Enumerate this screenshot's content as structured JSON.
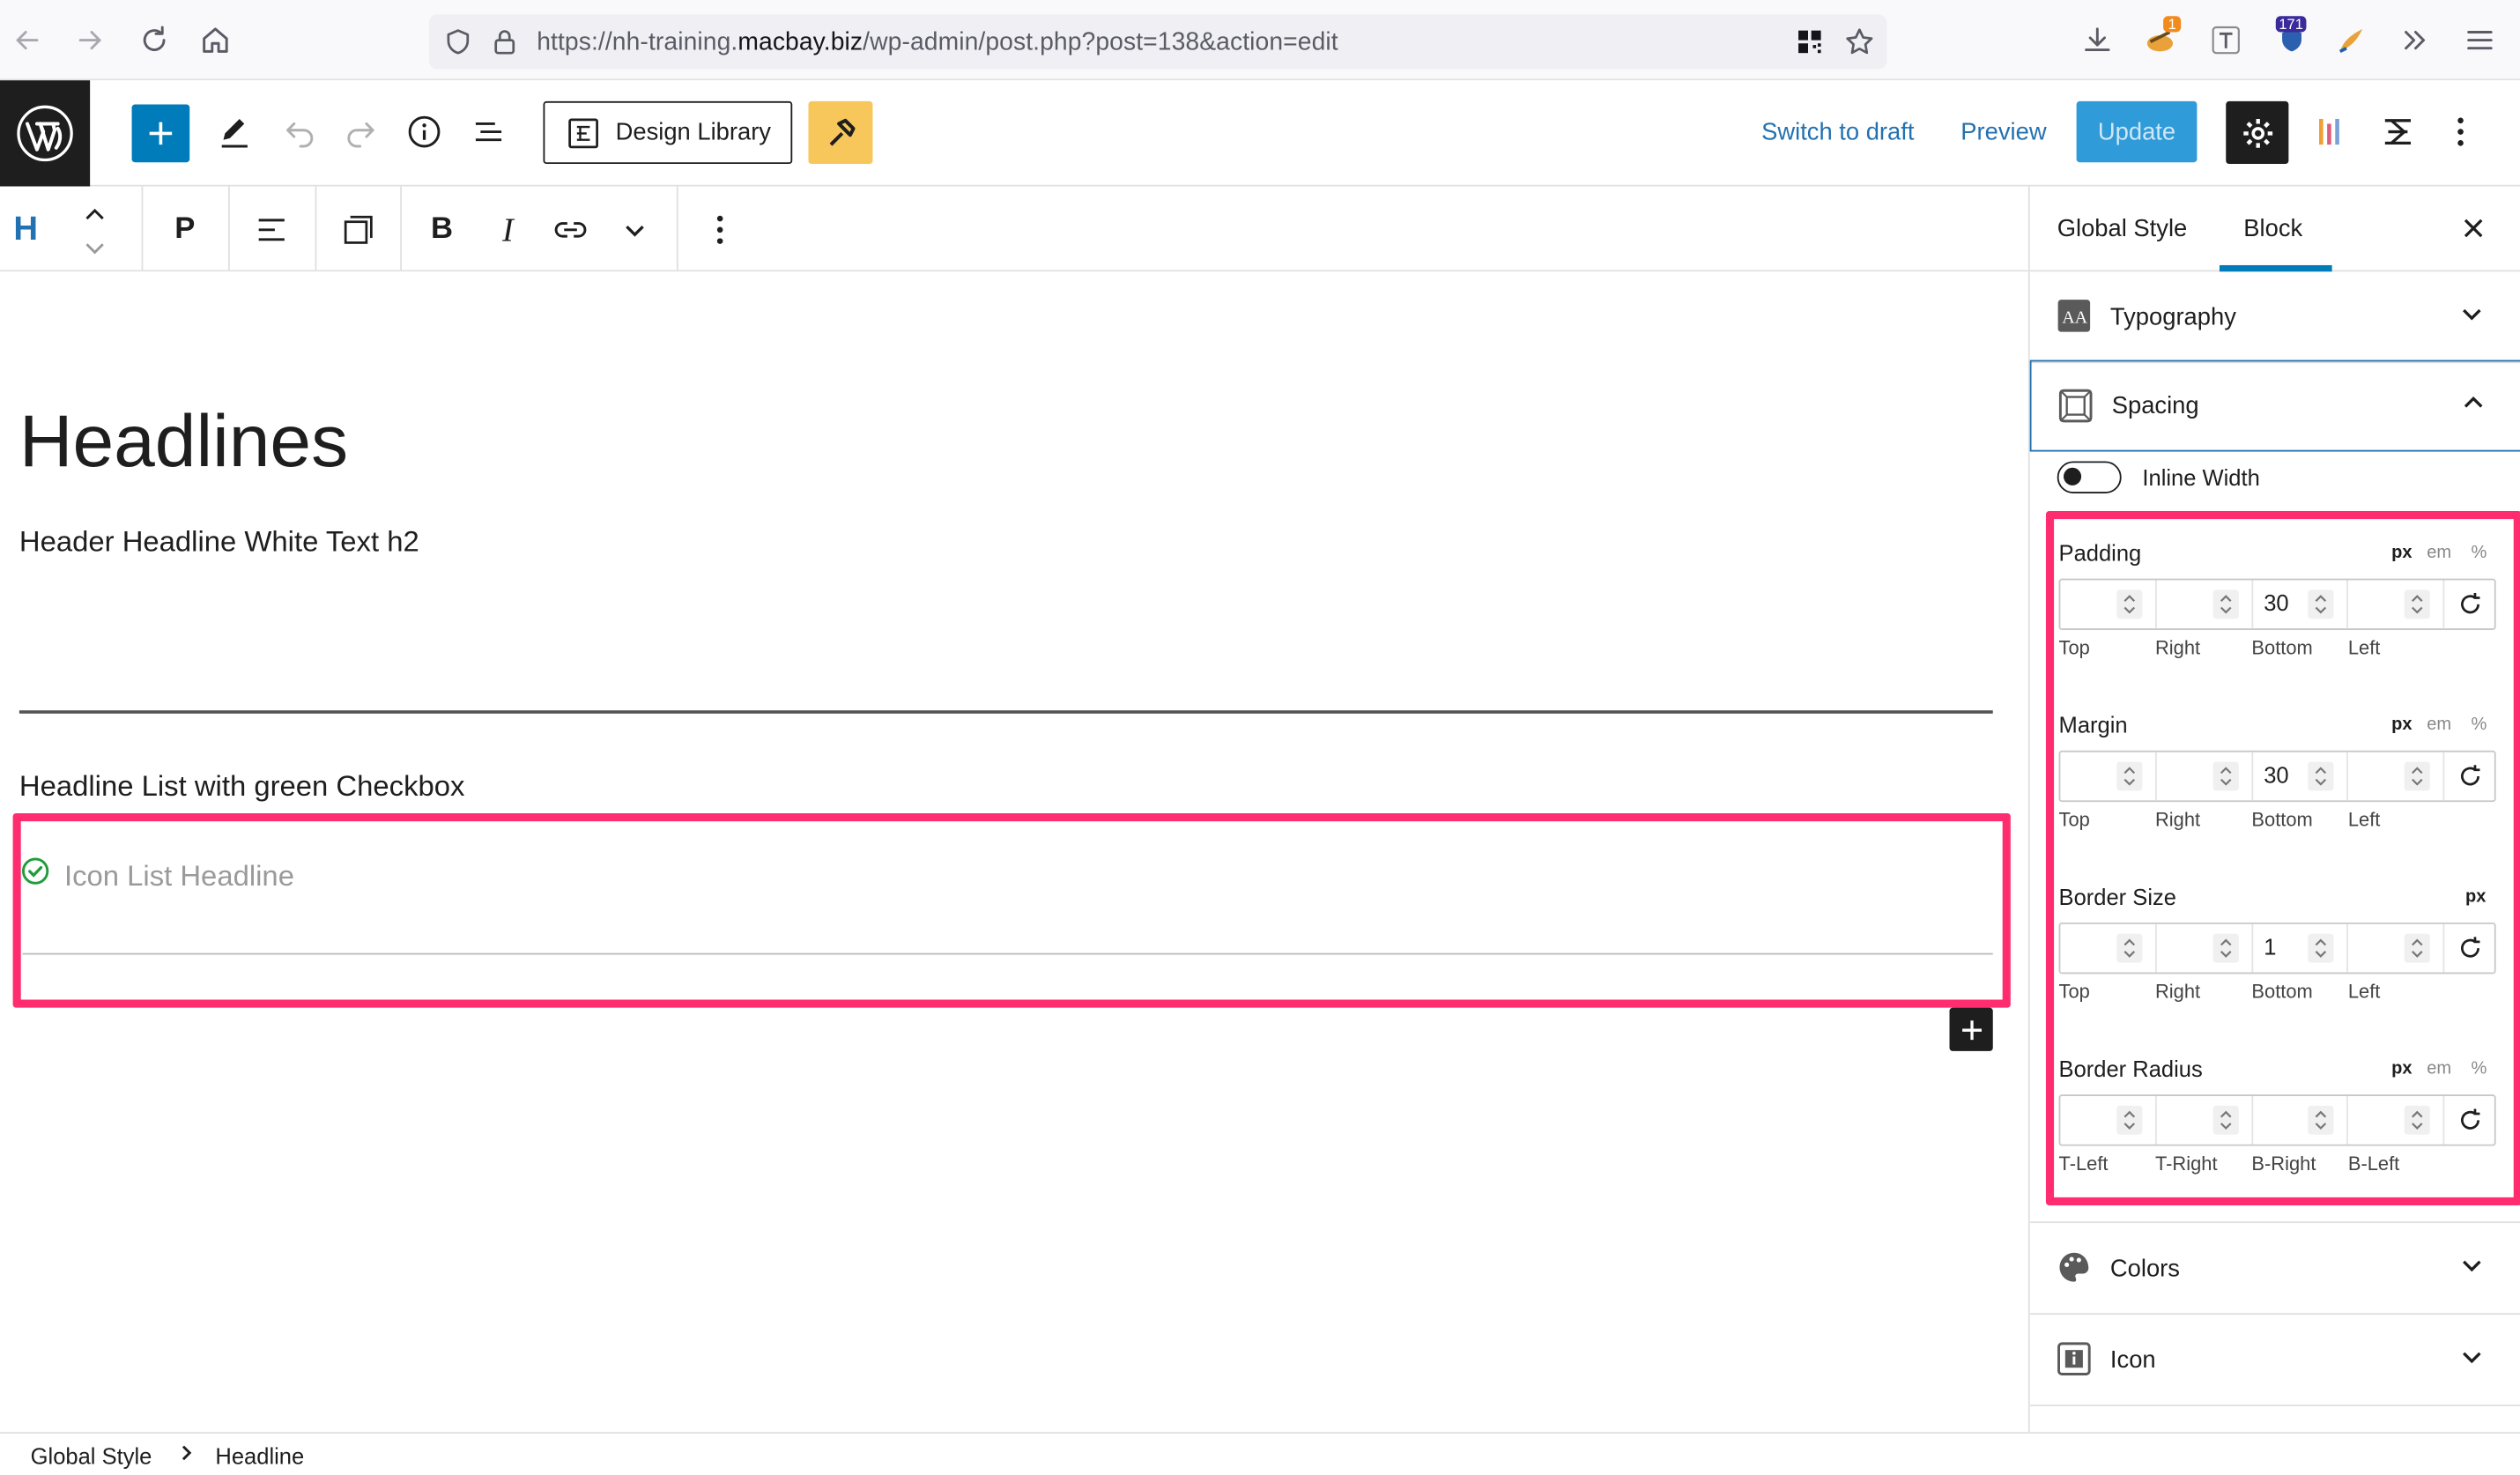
{
  "browser": {
    "url_prefix": "https://nh-training.",
    "url_domain": "macbay.biz",
    "url_path": "/wp-admin/post.php?post=138&action=edit",
    "badge_one": "1",
    "badge_two": "171",
    "icons": [
      "back-arrow-icon",
      "forward-arrow-icon",
      "reload-icon",
      "home-icon",
      "shield-icon",
      "lock-icon",
      "qr-icon",
      "bookmark-star-icon",
      "download-icon",
      "extension-icon",
      "text-icon",
      "shield-extension-icon",
      "paint-icon",
      "overflow-icon",
      "menu-icon"
    ]
  },
  "header": {
    "design_library_label": "Design Library",
    "switch_to_draft_label": "Switch to draft",
    "preview_label": "Preview",
    "update_label": "Update",
    "colors": {
      "accent": "#007cba",
      "update_bg": "#2f9bd8",
      "yellow": "#f7c75b",
      "dark": "#1e1e1e"
    }
  },
  "toolbar": {
    "block_type_label": "H",
    "paragraph_label": "P",
    "bold_label": "B",
    "italic_label": "I"
  },
  "canvas": {
    "title": "Headlines",
    "paragraph_1": "Header Headline White Text h2",
    "paragraph_2": "Headline List with green Checkbox",
    "icon_list_placeholder": "Icon List Headline",
    "highlight_color": "#ff2d6f"
  },
  "sidebar": {
    "tab_global_style": "Global Style",
    "tab_block": "Block",
    "typography_label": "Typography",
    "spacing_label": "Spacing",
    "inline_width_label": "Inline Width",
    "padding": {
      "label": "Padding",
      "units": [
        "px",
        "em",
        "%"
      ],
      "active_unit": "px",
      "values": [
        "",
        "",
        "30",
        ""
      ],
      "sublabels": [
        "Top",
        "Right",
        "Bottom",
        "Left"
      ]
    },
    "margin": {
      "label": "Margin",
      "units": [
        "px",
        "em",
        "%"
      ],
      "active_unit": "px",
      "values": [
        "",
        "",
        "30",
        ""
      ],
      "sublabels": [
        "Top",
        "Right",
        "Bottom",
        "Left"
      ]
    },
    "border_size": {
      "label": "Border Size",
      "units": [
        "px"
      ],
      "active_unit": "px",
      "values": [
        "",
        "",
        "1",
        ""
      ],
      "sublabels": [
        "Top",
        "Right",
        "Bottom",
        "Left"
      ]
    },
    "border_radius": {
      "label": "Border Radius",
      "units": [
        "px",
        "em",
        "%"
      ],
      "active_unit": "px",
      "values": [
        "",
        "",
        "",
        ""
      ],
      "sublabels": [
        "T-Left",
        "T-Right",
        "B-Right",
        "B-Left"
      ]
    },
    "colors_label": "Colors",
    "icon_label": "Icon"
  },
  "footer": {
    "crumb_1": "Global Style",
    "crumb_2": "Headline"
  }
}
